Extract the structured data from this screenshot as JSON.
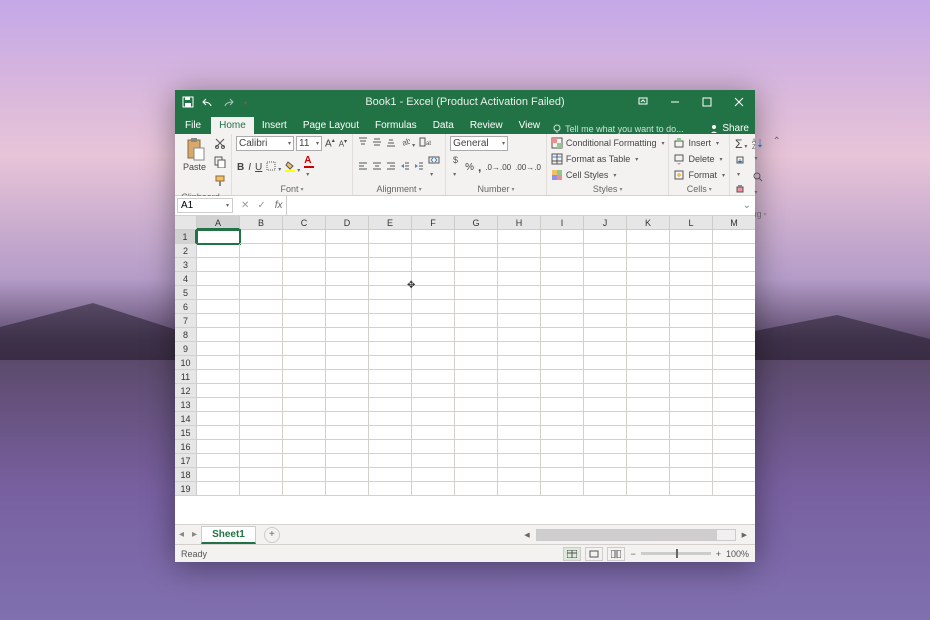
{
  "title": "Book1 - Excel (Product Activation Failed)",
  "tabs": {
    "file": "File",
    "home": "Home",
    "insert": "Insert",
    "page_layout": "Page Layout",
    "formulas": "Formulas",
    "data": "Data",
    "review": "Review",
    "view": "View",
    "tellme": "Tell me what you want to do...",
    "share": "Share"
  },
  "ribbon": {
    "clipboard": {
      "label": "Clipboard",
      "paste": "Paste"
    },
    "font": {
      "label": "Font",
      "name": "Calibri",
      "size": "11"
    },
    "alignment": {
      "label": "Alignment"
    },
    "number": {
      "label": "Number",
      "format": "General"
    },
    "styles": {
      "label": "Styles",
      "cond": "Conditional Formatting",
      "table": "Format as Table",
      "cell": "Cell Styles"
    },
    "cells": {
      "label": "Cells",
      "insert": "Insert",
      "delete": "Delete",
      "format": "Format"
    },
    "editing": {
      "label": "Editing"
    }
  },
  "namebox": "A1",
  "columns": [
    "A",
    "B",
    "C",
    "D",
    "E",
    "F",
    "G",
    "H",
    "I",
    "J",
    "K",
    "L",
    "M"
  ],
  "rows": 19,
  "sheet": "Sheet1",
  "status": "Ready",
  "zoom": "100%",
  "selected_cell": "A1"
}
